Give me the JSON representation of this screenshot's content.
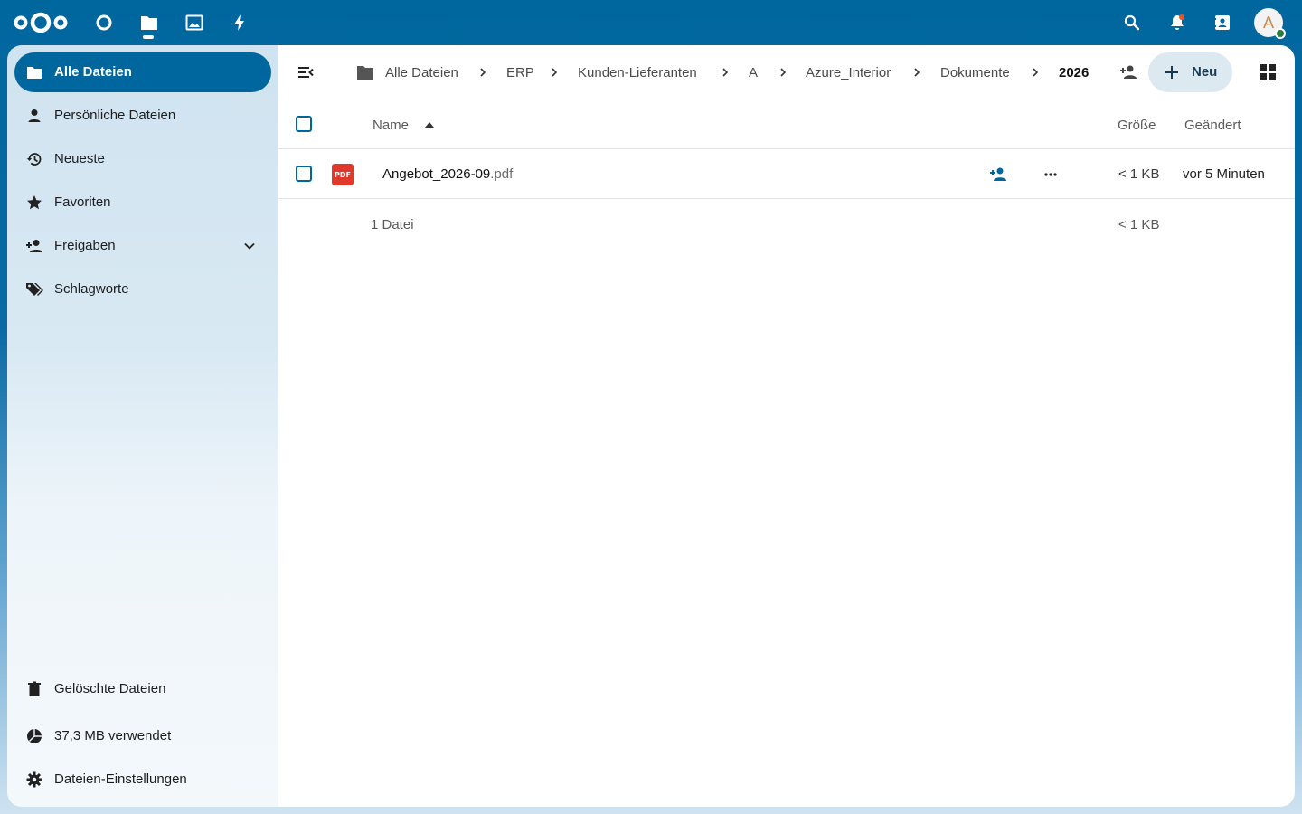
{
  "colors": {
    "brand": "#00679e",
    "header_bg": "#00679e",
    "pdf_red": "#e0392c",
    "share_blue": "#00679e"
  },
  "header": {
    "logo_icon": "nextcloud-logo",
    "apps": [
      {
        "name": "dashboard",
        "icon": "circle-icon"
      },
      {
        "name": "files",
        "icon": "folder-icon",
        "active": true
      },
      {
        "name": "photos",
        "icon": "image-icon"
      },
      {
        "name": "activity",
        "icon": "lightning-icon"
      }
    ],
    "right_icons": [
      "search-icon",
      "bell-icon",
      "contacts-icon"
    ],
    "avatar_letter": "A"
  },
  "sidebar": {
    "items": [
      {
        "label": "Alle Dateien",
        "icon": "folder-icon",
        "active": true
      },
      {
        "label": "Persönliche Dateien",
        "icon": "person-icon"
      },
      {
        "label": "Neueste",
        "icon": "history-icon"
      },
      {
        "label": "Favoriten",
        "icon": "star-icon"
      },
      {
        "label": "Freigaben",
        "icon": "share-icon",
        "expandable": true
      },
      {
        "label": "Schlagworte",
        "icon": "tag-icon"
      }
    ],
    "bottom": [
      {
        "label": "Gelöschte Dateien",
        "icon": "trash-icon"
      },
      {
        "label": "37,3 MB verwendet",
        "icon": "pie-chart-icon"
      },
      {
        "label": "Dateien-Einstellungen",
        "icon": "gear-icon"
      }
    ]
  },
  "breadcrumb": {
    "items": [
      "Alle Dateien",
      "ERP",
      "Kunden-Lieferanten",
      "A",
      "Azure_Interior",
      "Dokumente",
      "2026"
    ]
  },
  "toolbar": {
    "new_label": "Neu"
  },
  "table": {
    "columns": {
      "name": "Name",
      "size": "Größe",
      "modified": "Geändert"
    },
    "rows": [
      {
        "basename": "Angebot_2026-09",
        "extension": ".pdf",
        "type_badge": "PDF",
        "size": "< 1 KB",
        "modified": "vor 5 Minuten"
      }
    ],
    "summary": {
      "count": "1 Datei",
      "size": "< 1 KB"
    }
  }
}
